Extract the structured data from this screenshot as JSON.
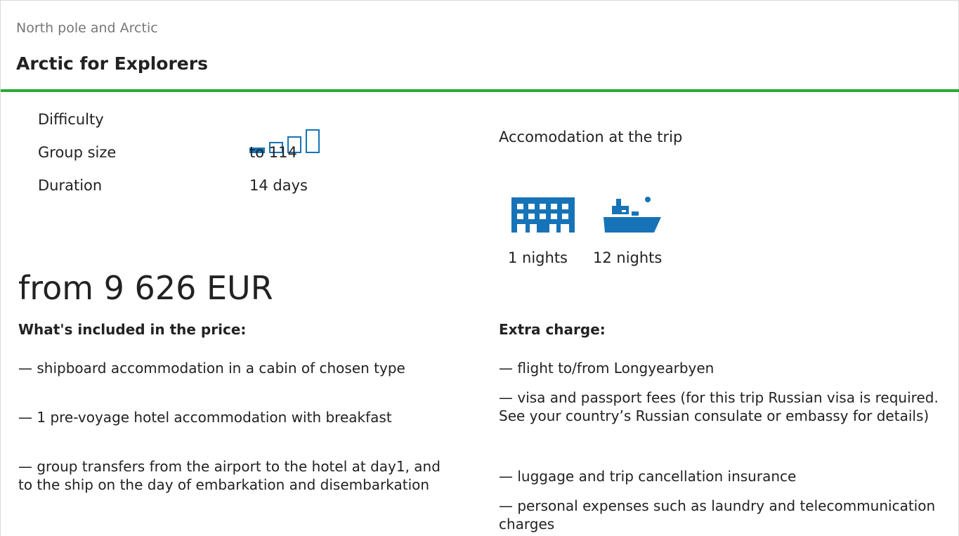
{
  "header": {
    "region": "North pole and Arctic",
    "title": "Arctic for Explorers"
  },
  "specs": {
    "difficulty_label": "Difficulty",
    "difficulty_level": 1,
    "difficulty_max": 4,
    "group_label": "Group size",
    "group_value": "to 114",
    "duration_label": "Duration",
    "duration_value": "14 days"
  },
  "price": "from 9 626 EUR",
  "accommodation": {
    "title": "Accomodation at the trip",
    "items": [
      {
        "icon": "hotel-icon",
        "nights": "1 nights"
      },
      {
        "icon": "ship-icon",
        "nights": "12 nights"
      }
    ]
  },
  "included": {
    "title": "What's included in the price:",
    "items": [
      "— shipboard accommodation in a cabin of chosen type",
      "— 1 pre-voyage hotel accommodation with breakfast",
      "— group transfers from the airport to the hotel at day1, and to the ship on the day of embarkation and disembarkation"
    ]
  },
  "extra": {
    "title": "Extra charge:",
    "items": [
      "— flight to/from Longyearbyen",
      "— visa and passport fees (for this trip Russian visa is required. See your country’s Russian consulate or embassy for details)",
      "— luggage and trip cancellation insurance",
      "— personal expenses such as laundry and telecommunication charges"
    ]
  },
  "colors": {
    "accent_green": "#2aaa38",
    "icon_blue": "#1673b8"
  }
}
